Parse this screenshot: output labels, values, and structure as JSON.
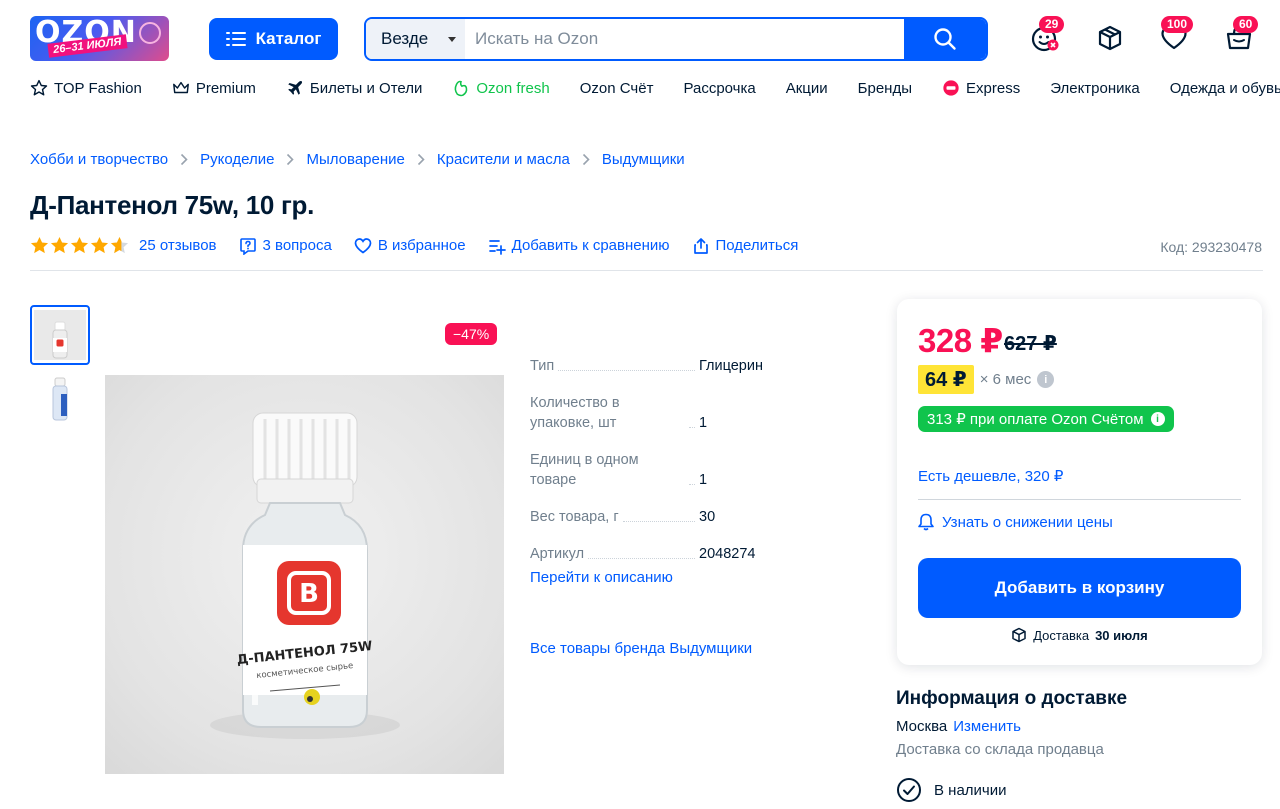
{
  "header": {
    "logo_word": "OZON",
    "logo_dates": "26–31 ИЮЛЯ",
    "catalog_label": "Каталог",
    "search_scope": "Везде",
    "search_placeholder": "Искать на Ozon",
    "icons": [
      {
        "name": "smile-icon",
        "badge": "29"
      },
      {
        "name": "box-icon",
        "badge": ""
      },
      {
        "name": "heart-icon",
        "badge": "100"
      },
      {
        "name": "cart-icon",
        "badge": "60"
      }
    ]
  },
  "nav": [
    {
      "label": "TOP Fashion",
      "icon": "star-outline-icon"
    },
    {
      "label": "Premium",
      "icon": "crown-icon"
    },
    {
      "label": "Билеты и Отели",
      "icon": "plane-icon"
    },
    {
      "label": "Ozon fresh",
      "icon": "fresh-icon"
    },
    {
      "label": "Ozon Счёт",
      "icon": ""
    },
    {
      "label": "Рассрочка",
      "icon": ""
    },
    {
      "label": "Акции",
      "icon": ""
    },
    {
      "label": "Бренды",
      "icon": ""
    },
    {
      "label": "Express",
      "icon": "express-icon"
    },
    {
      "label": "Электроника",
      "icon": ""
    },
    {
      "label": "Одежда и обувь",
      "icon": ""
    }
  ],
  "breadcrumbs": [
    "Хобби и творчество",
    "Рукоделие",
    "Мыловарение",
    "Красители и масла",
    "Выдумщики"
  ],
  "product": {
    "title": "Д-Пантенол 75w, 10 гр.",
    "rating": 4.5,
    "reviews": "25 отзывов",
    "questions": "3 вопроса",
    "favorite": "В избранное",
    "compare": "Добавить к сравнению",
    "share": "Поделиться",
    "code": "Код: 293230478",
    "discount": "−47%",
    "bottle_label": "Д-ПАНТЕНОЛ 75W",
    "bottle_sub": "косметическое сырье",
    "specs": [
      {
        "key": "Тип",
        "value": "Глицерин"
      },
      {
        "key": "Количество в упаковке, шт",
        "value": "1"
      },
      {
        "key": "Единиц в одном товаре",
        "value": "1"
      },
      {
        "key": "Вес товара, г",
        "value": "30"
      },
      {
        "key": "Артикул",
        "value": "2048274"
      }
    ],
    "to_description": "Перейти к описанию",
    "brand_all": "Все товары бренда Выдумщики"
  },
  "price_card": {
    "price": "328 ₽",
    "old_price": "627 ₽",
    "installment_amount": "64 ₽",
    "installment_term": "× 6 мес",
    "ozon_card_price": "313 ₽ при оплате Ozon Счётом",
    "cheaper": "Есть дешевле, 320 ₽",
    "notify": "Узнать о снижении цены",
    "add_to_cart": "Добавить в корзину",
    "delivery_prefix": "Доставка",
    "delivery_date": "30 июля"
  },
  "delivery_info": {
    "title": "Информация о доставке",
    "city": "Москва",
    "change": "Изменить",
    "source": "Доставка со склада продавца",
    "stock": "В наличии"
  },
  "colors": {
    "accent": "#005bff",
    "sale": "#f91155",
    "green": "#10c44c",
    "yellow": "#ffe436"
  }
}
